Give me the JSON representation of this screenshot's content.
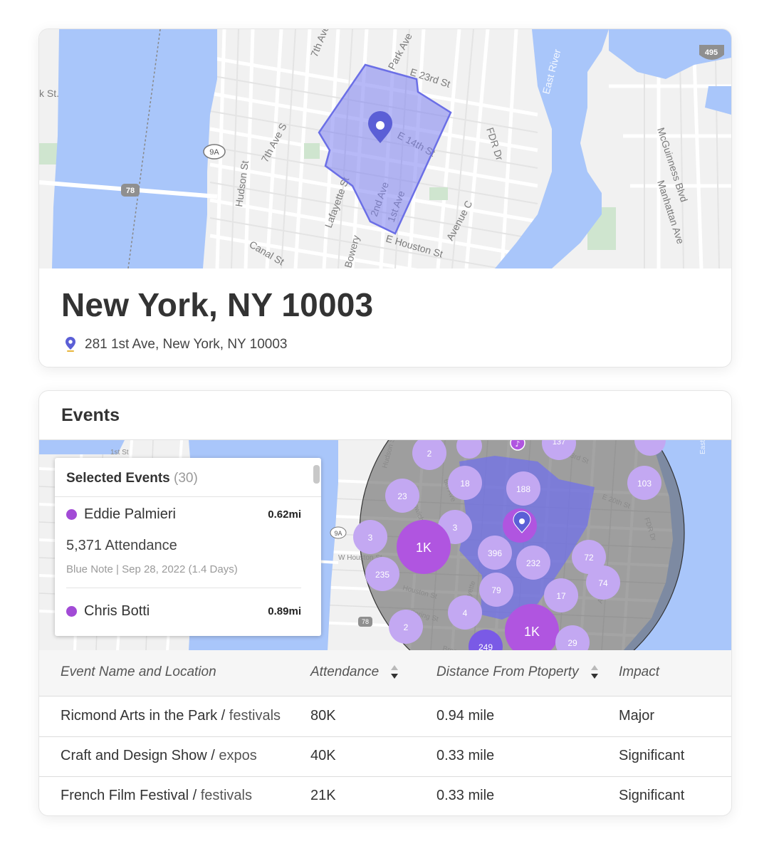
{
  "location": {
    "title": "New York, NY 10003",
    "address": "281 1st Ave, New York, NY 10003",
    "map_labels": [
      "k St.",
      "7th Ave",
      "Park Ave",
      "E 23rd St",
      "East River",
      "495",
      "7th Ave S",
      "9A",
      "Hudson St",
      "E 14th St",
      "FDR Dr",
      "McGuinness Blvd",
      "Manhattan Ave",
      "78",
      "Lafayette St",
      "2nd Ave",
      "1st Ave",
      "Avenue C",
      "Canal St",
      "Bowery",
      "E Houston St"
    ]
  },
  "events": {
    "title": "Events",
    "selected": {
      "title": "Selected Events",
      "count": "(30)",
      "items": [
        {
          "name": "Eddie Palmieri",
          "distance": "0.62mi",
          "attendance": "5,371 Attendance",
          "meta": "Blue Note | Sep 28, 2022 (1.4 Days)"
        },
        {
          "name": "Chris Botti",
          "distance": "0.89mi"
        }
      ]
    },
    "map_labels": [
      "1st St",
      "W Houston St",
      "Houston St",
      "Spring St",
      "Hudson St",
      "Greenwich Ave",
      "6th Ave",
      "23rd St",
      "E 20th St",
      "FDR Dr",
      "Avenue C",
      "Lafayette",
      "Broome",
      "9A",
      "78",
      "East"
    ],
    "clusters": [
      "2",
      "18",
      "188",
      "23",
      "103",
      "3",
      "3",
      "1K",
      "396",
      "232",
      "72",
      "235",
      "79",
      "74",
      "17",
      "4",
      "2",
      "1K",
      "249",
      "29",
      "137"
    ],
    "table": {
      "columns": [
        "Event Name and Location",
        "Attendance",
        "Distance From Ptoperty",
        "Impact"
      ],
      "rows": [
        {
          "name": "Ricmond Arts in the Park",
          "category": "festivals",
          "attendance": "80K",
          "distance": "0.94 mile",
          "impact": "Major"
        },
        {
          "name": "Craft and Design Show",
          "category": "expos",
          "attendance": "40K",
          "distance": "0.33 mile",
          "impact": "Significant"
        },
        {
          "name": "French Film Festival",
          "category": "festivals",
          "attendance": "21K",
          "distance": "0.33 mile",
          "impact": "Significant"
        }
      ]
    }
  },
  "colors": {
    "water": "#a9c6fa",
    "land": "#f1f1f1",
    "polygon": "#7b7ff0",
    "cluster": "#c3a8f2",
    "cluster_strong": "#b055e0",
    "pin": "#5b5fd6"
  }
}
